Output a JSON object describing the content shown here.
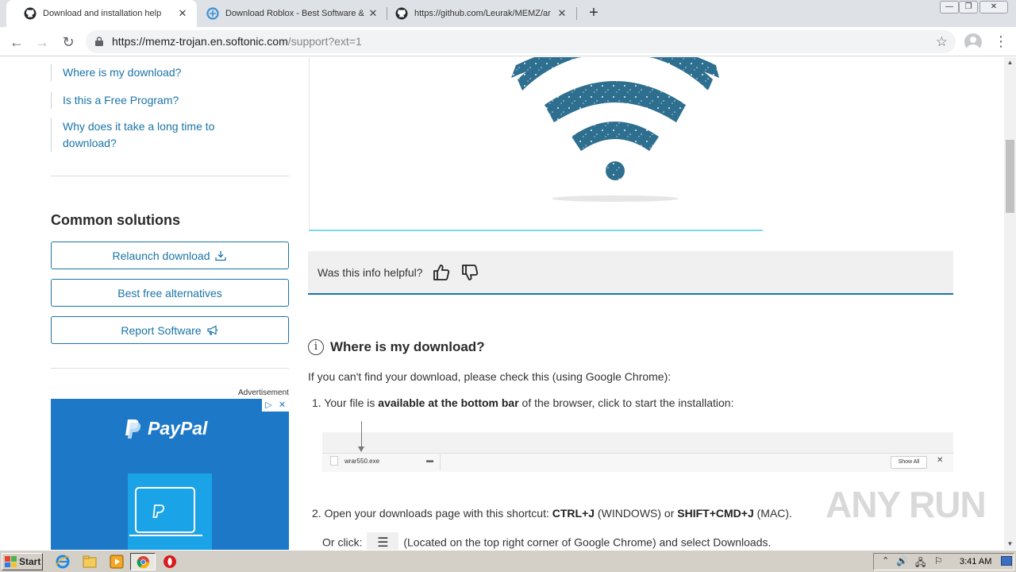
{
  "browser": {
    "tabs": [
      {
        "title": "Download and installation help",
        "active": true,
        "icon": "github-icon"
      },
      {
        "title": "Download Roblox - Best Software &",
        "active": false,
        "icon": "softonic-icon"
      },
      {
        "title": "https://github.com/Leurak/MEMZ/ar",
        "active": false,
        "icon": "github-icon"
      }
    ],
    "url_host": "https://memz-trojan.en.softonic.com",
    "url_path": "/support?ext=1"
  },
  "sidebar": {
    "links": [
      "Where is my download?",
      "Is this a Free Program?",
      "Why does it take a long time to download?"
    ],
    "common_title": "Common solutions",
    "buttons": {
      "relaunch": "Relaunch download",
      "alternatives": "Best free alternatives",
      "report": "Report Software"
    },
    "ad_label": "Advertisement",
    "ad_brand": "PayPal",
    "ad_choices": [
      "▷",
      "✕"
    ]
  },
  "feedback": {
    "question": "Was this info helpful?"
  },
  "article": {
    "heading": "Where is my download?",
    "intro": "If you can't find your download, please check this (using Google Chrome):",
    "step1_num": "1.",
    "step1_a": "Your file is ",
    "step1_b": "available at the bottom bar",
    "step1_c": " of the browser, click to start the installation:",
    "shot_file": "wrar550.exe",
    "shot_showall": "Show All",
    "step2_num": "2.",
    "step2_a": "Open your downloads page with this shortcut: ",
    "step2_b": "CTRL+J",
    "step2_c": " (WINDOWS) or ",
    "step2_d": "SHIFT+CMD+J",
    "step2_e": " (MAC).",
    "step3_a": "Or click:",
    "step3_b": "(Located on the top right corner of Google Chrome) and select Downloads."
  },
  "watermark": "ANY RUN",
  "taskbar": {
    "start": "Start",
    "clock": "3:41 AM"
  }
}
